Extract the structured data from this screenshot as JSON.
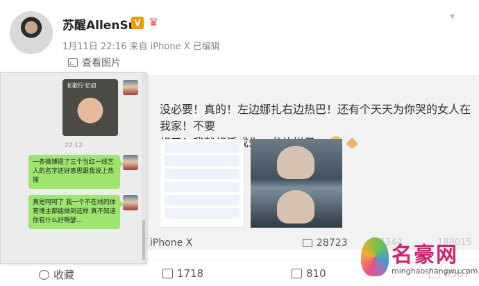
{
  "post": {
    "author": "苏醒AllenSu",
    "verified_badge": "V",
    "meta": "1月11日 22:16 来自 iPhone X   已编辑",
    "view_pics": "查看图片"
  },
  "repost": {
    "text_line1": "没必要！真的！左边娜扎右边热巴！还有个天天为你哭的女人在我家！不要",
    "text_line2": "想了！我就想活成朱一龙的样子…",
    "source": "iPhone X",
    "repost_count": "28723",
    "faded_count_1": "33344",
    "faded_count_2": "188015",
    "faded_count_3": "6387"
  },
  "chat": {
    "photo_label": "长歌行·忆初",
    "time": "22:12",
    "message1": "一条微博提了三个当红一线艺人的名字还好意思跟我说上热搜",
    "message2": "真是呵呵了 我一个不在线的体育博主都能做到这样 真不知道你有什么好嘚瑟..."
  },
  "bottom_bar": {
    "favorite": "收藏",
    "repost": "1718",
    "comment": "810"
  },
  "watermark": {
    "name": "名豪网",
    "url": "minghaoshangwu.com"
  },
  "colors": {
    "accent": "#f29b00",
    "bubble": "#9de66e",
    "watermark": "#d81e6b"
  },
  "icons": [
    "more-dots-icon",
    "picture-icon",
    "crown-icon",
    "star-icon",
    "repost-icon",
    "comment-icon",
    "like-icon"
  ]
}
